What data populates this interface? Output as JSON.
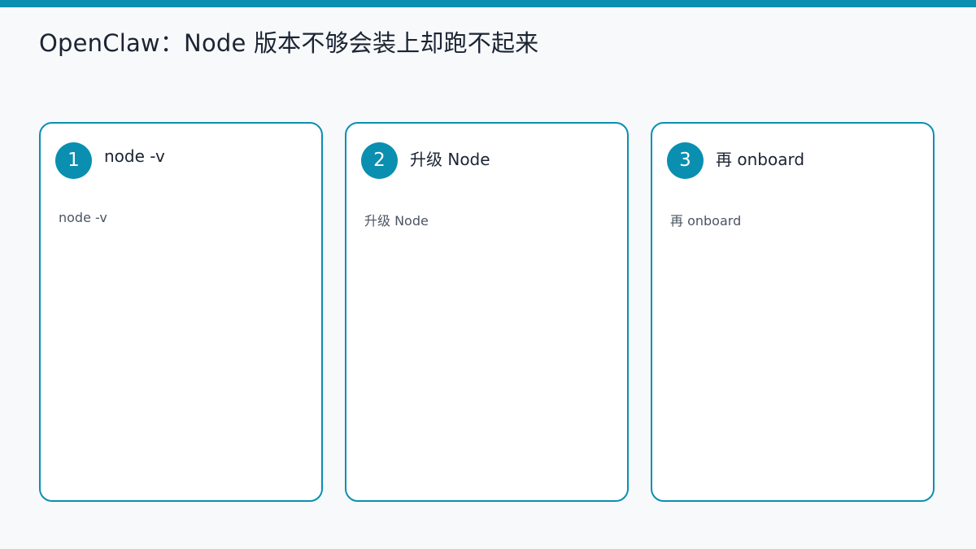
{
  "title": "OpenClaw：Node 版本不够会装上却跑不起来",
  "colors": {
    "accent": "#0a8fb0",
    "background": "#f7f9fb",
    "card_background": "#ffffff",
    "title_text": "#1b2433",
    "body_text": "#4b5563"
  },
  "steps": [
    {
      "number": "1",
      "title": "node -v",
      "body": "node -v"
    },
    {
      "number": "2",
      "title": "升级 Node",
      "body": "升级 Node"
    },
    {
      "number": "3",
      "title": "再 onboard",
      "body": "再 onboard"
    }
  ]
}
